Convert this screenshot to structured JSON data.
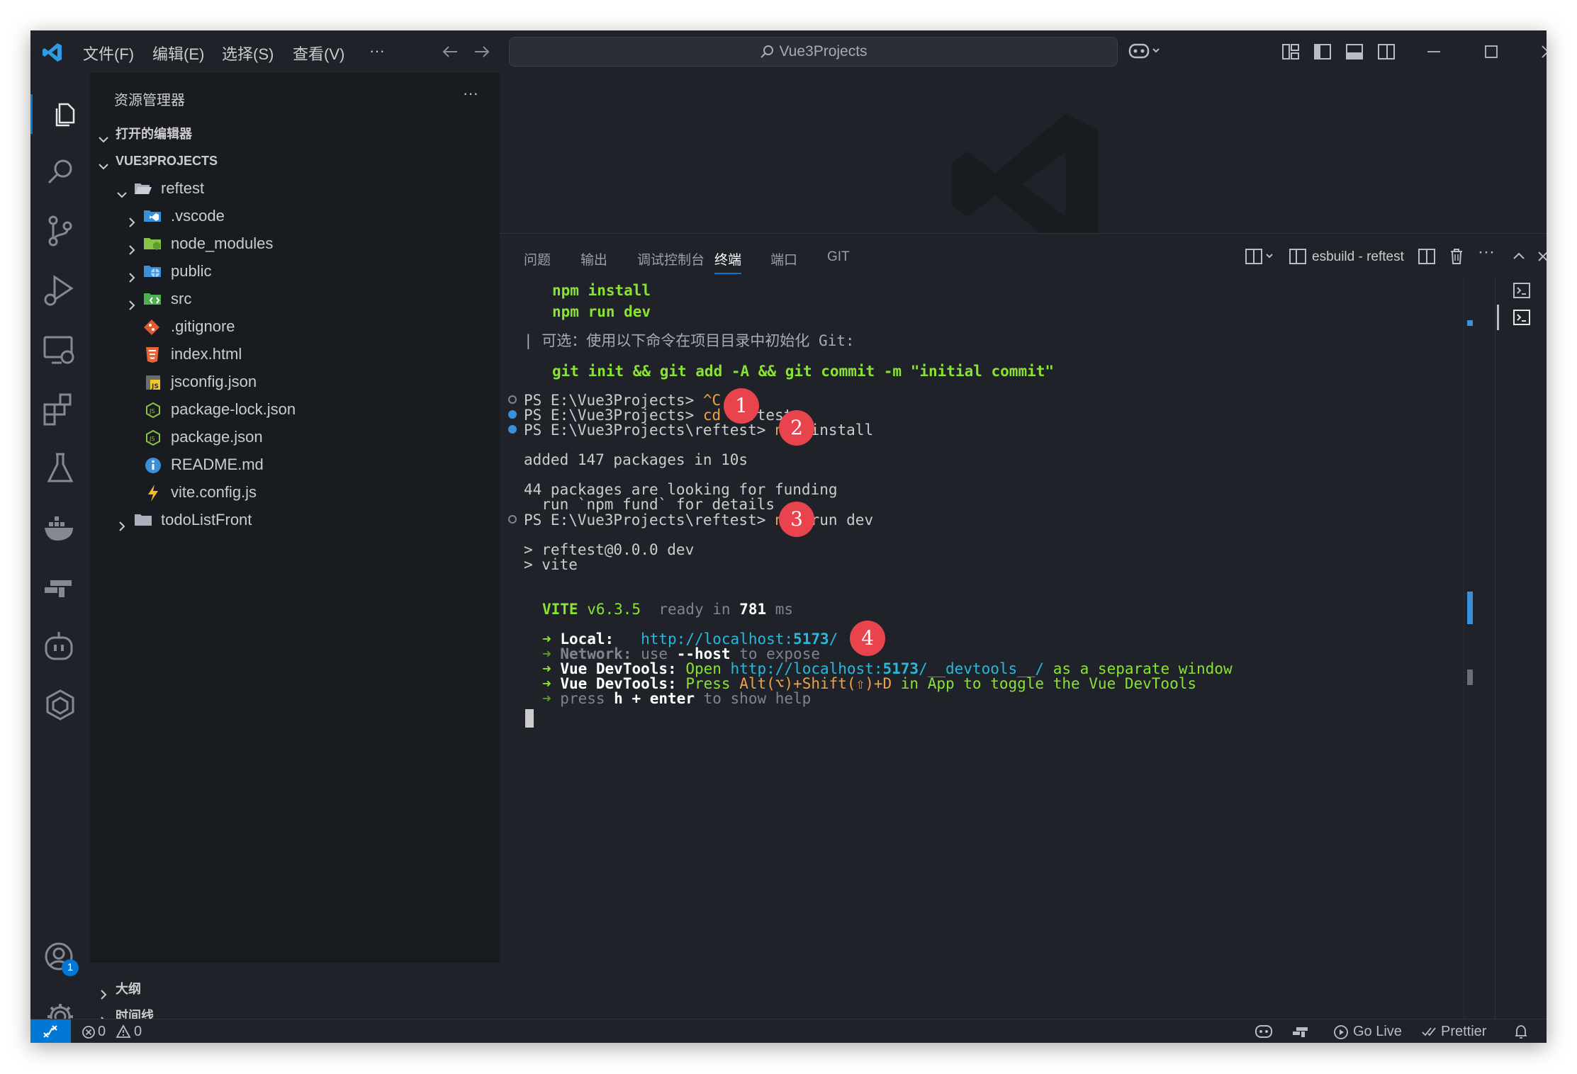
{
  "titlebar": {
    "menus": [
      "文件(F)",
      "编辑(E)",
      "选择(S)",
      "查看(V)",
      "···"
    ],
    "search_text": "Vue3Projects"
  },
  "activity_icons": [
    "explorer-icon",
    "search-icon",
    "source-control-icon",
    "run-debug-icon",
    "remote-explorer-icon",
    "extensions-icon",
    "testing-icon",
    "docker-icon",
    "gitlens-icon",
    "copilot-icon",
    "kubernetes-icon",
    "accounts-icon",
    "settings-gear-icon"
  ],
  "accounts_badge": "1",
  "sidebar": {
    "title": "资源管理器",
    "more": "···",
    "open_editors": "打开的编辑器",
    "project": "VUE3PROJECTS",
    "tree": [
      {
        "label": "reftest",
        "kind": "folder-open",
        "level": 1
      },
      {
        "label": ".vscode",
        "kind": "vscode-folder",
        "level": 2
      },
      {
        "label": "node_modules",
        "kind": "node-folder",
        "level": 2
      },
      {
        "label": "public",
        "kind": "public-folder",
        "level": 2
      },
      {
        "label": "src",
        "kind": "src-folder",
        "level": 2
      },
      {
        "label": ".gitignore",
        "kind": "git",
        "level": 2
      },
      {
        "label": "index.html",
        "kind": "html",
        "level": 2
      },
      {
        "label": "jsconfig.json",
        "kind": "jsconfig",
        "level": 2
      },
      {
        "label": "package-lock.json",
        "kind": "npm",
        "level": 2
      },
      {
        "label": "package.json",
        "kind": "npm",
        "level": 2
      },
      {
        "label": "README.md",
        "kind": "info",
        "level": 2
      },
      {
        "label": "vite.config.js",
        "kind": "vite",
        "level": 2
      },
      {
        "label": "todoListFront",
        "kind": "folder",
        "level": 1
      }
    ],
    "outline": "大纲",
    "timeline": "时间线"
  },
  "panel": {
    "tabs": [
      "问题",
      "输出",
      "调试控制台",
      "终端",
      "端口",
      "GIT"
    ],
    "active_tab": "终端",
    "terminal_name": "esbuild - reftest"
  },
  "terminal": {
    "l1": "npm install",
    "l2": "npm run dev",
    "l3a": "| ",
    "l3b": "可选：使用以下命令在项目目录中初始化 Git:",
    "l4": "git init && git add -A && git commit -m \"initial commit\"",
    "p1": "PS E:\\Vue3Projects> ",
    "p1c": "^C",
    "p2": "PS E:\\Vue3Projects> ",
    "p2c": "cd",
    "p2a": " reftest",
    "p3": "PS E:\\Vue3Projects\\reftest> ",
    "p3c": "npm",
    "p3a": " install",
    "o1": "added 147 packages in 10s",
    "o2": "44 packages are looking for funding",
    "o3": "  run `npm fund` for details",
    "p4": "PS E:\\Vue3Projects\\reftest> ",
    "p4c": "npm",
    "p4a": " run dev",
    "o4": "> reftest@0.0.0 dev",
    "o5": "> vite",
    "vite": "VITE",
    "vite_ver": " v6.3.5",
    "ready": "  ready in ",
    "ready_ms": "781",
    "ready_unit": " ms",
    "arrow": "➜",
    "local_label": "Local:",
    "local_url_a": "http://localhost:",
    "local_port": "5173",
    "local_url_b": "/",
    "network_label": "Network:",
    "network_a": " use ",
    "network_b": "--host",
    "network_c": " to expose",
    "dev1_label": "Vue DevTools:",
    "dev1_a": " Open ",
    "dev1_url_a": "http://localhost:",
    "dev1_port": "5173",
    "dev1_url_b": "/__devtools__/",
    "dev1_c": " as a separate window",
    "dev2_label": "Vue DevTools:",
    "dev2_a": " Press ",
    "dev2_keys": "Alt(⌥)+Shift(⇧)+D",
    "dev2_b": " in App to toggle the Vue DevTools",
    "help_a": " press ",
    "help_b": "h + enter",
    "help_c": " to show help"
  },
  "annotations": [
    "1",
    "2",
    "3",
    "4"
  ],
  "statusbar": {
    "errors": "0",
    "warnings": "0",
    "golive": "Go Live",
    "prettier": "Prettier"
  },
  "colors": {
    "accent": "#0078d4",
    "badge": "#e9444d",
    "terminal_green": "#8ae234",
    "terminal_yellow": "#f0a145",
    "terminal_cyan": "#29b8db"
  }
}
